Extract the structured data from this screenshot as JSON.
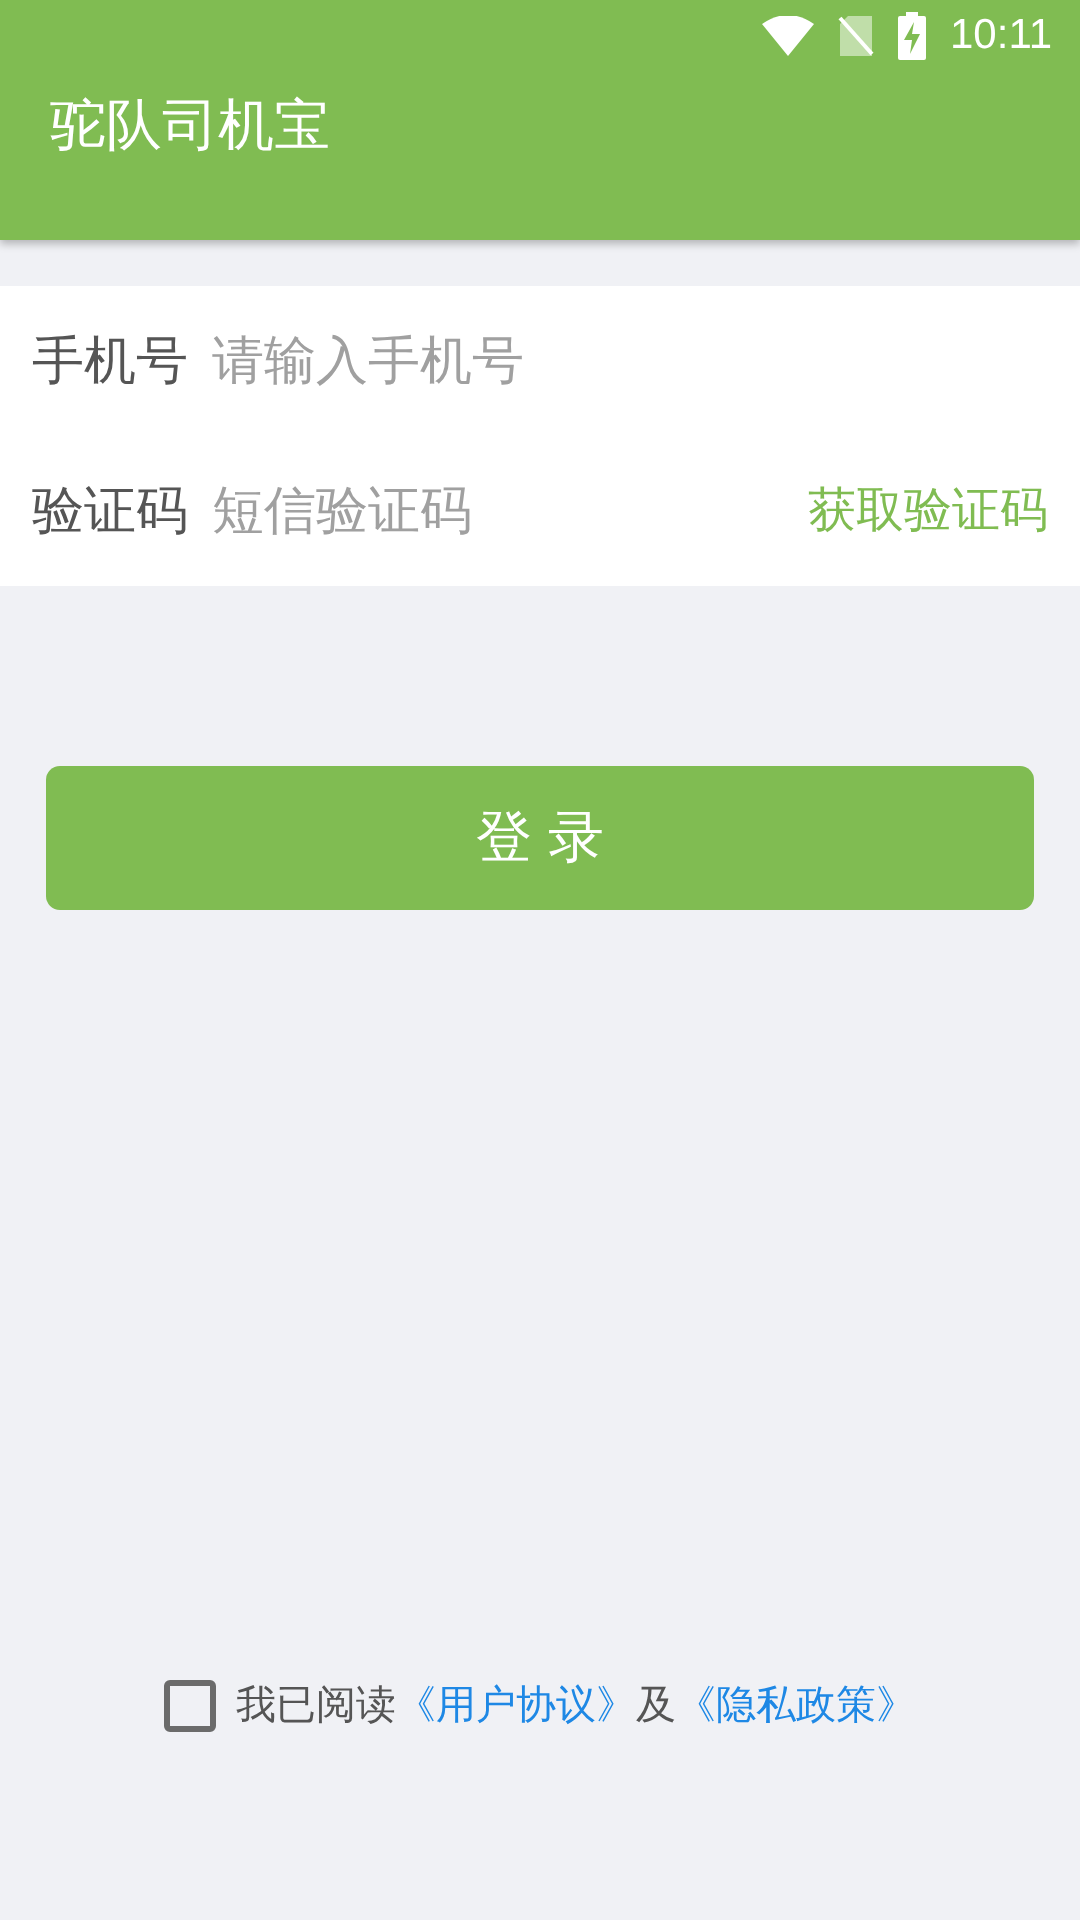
{
  "status_bar": {
    "time": "10:11"
  },
  "app_bar": {
    "title": "驼队司机宝"
  },
  "form": {
    "fields": [
      {
        "label": "手机号",
        "placeholder": "请输入手机号"
      },
      {
        "label": "验证码",
        "placeholder": "短信验证码",
        "action": "获取验证码"
      }
    ]
  },
  "login_button": "登 录",
  "agreement": {
    "checked": false,
    "prefix": "我已阅读",
    "links": [
      "《用户协议》",
      "《隐私政策》"
    ],
    "joiner": "及"
  }
}
